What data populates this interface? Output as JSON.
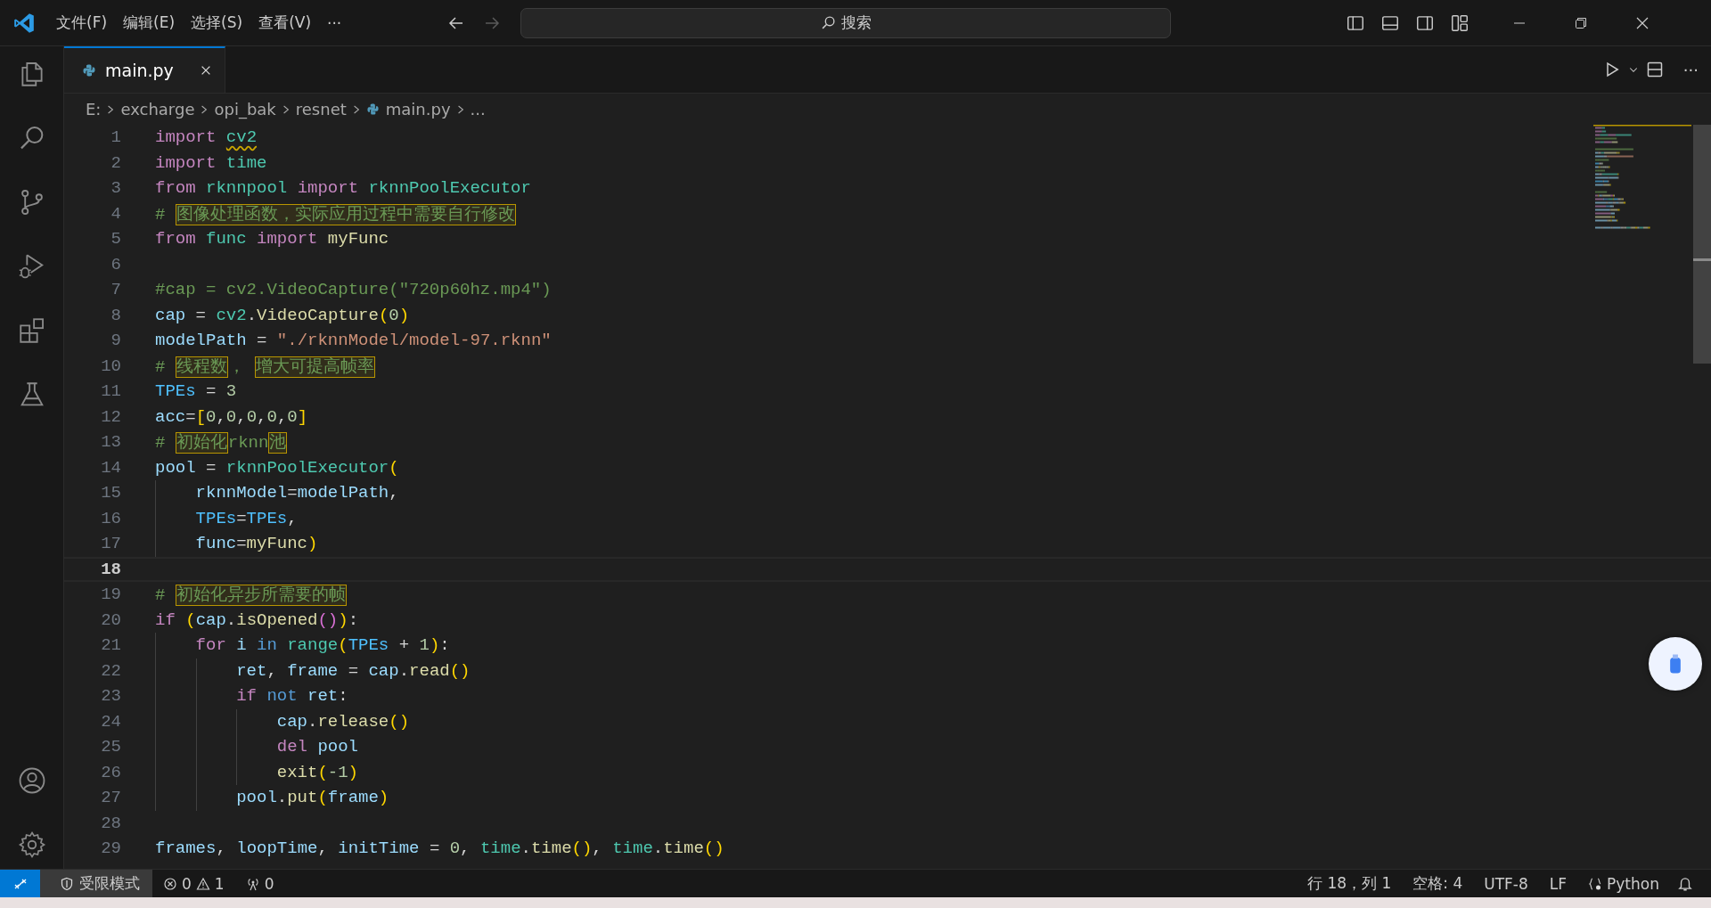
{
  "title_bar": {
    "menus": [
      "文件(F)",
      "编辑(E)",
      "选择(S)",
      "查看(V)"
    ],
    "more": "···",
    "nav": [
      {
        "kind": "back",
        "disabled": false
      },
      {
        "kind": "forward",
        "disabled": true
      }
    ],
    "search": "搜索"
  },
  "tabs": [
    {
      "label": "main.py",
      "selected": true
    }
  ],
  "editor_actions": {
    "more": "···"
  },
  "breadcrumb": [
    {
      "label": "E:",
      "kind": "folder"
    },
    {
      "label": "excharge",
      "kind": "folder"
    },
    {
      "label": "opi_bak",
      "kind": "folder"
    },
    {
      "label": "resnet",
      "kind": "folder"
    },
    {
      "label": "main.py",
      "kind": "file"
    },
    {
      "label": "...",
      "kind": "more"
    }
  ],
  "editor": {
    "lines": [
      {
        "number": "1",
        "current": false,
        "tokens": [
          {
            "kind": "kw",
            "text": "import "
          },
          {
            "kind": "mod-warn",
            "text": "cv2"
          }
        ]
      },
      {
        "number": "2",
        "current": false,
        "tokens": [
          {
            "kind": "kw",
            "text": "import "
          },
          {
            "kind": "mod",
            "text": "time"
          }
        ]
      },
      {
        "number": "3",
        "current": false,
        "tokens": [
          {
            "kind": "kw",
            "text": "from "
          },
          {
            "kind": "mod",
            "text": "rknnpool"
          },
          {
            "kind": "kw",
            "text": " import "
          },
          {
            "kind": "mod",
            "text": "rknnPoolExecutor"
          }
        ]
      },
      {
        "number": "4",
        "current": false,
        "tokens": [
          {
            "kind": "cmt",
            "text": "# "
          },
          {
            "kind": "hl",
            "text": "图像处理函数，实际应用过程中需要自行修改"
          }
        ]
      },
      {
        "number": "5",
        "current": false,
        "tokens": [
          {
            "kind": "kw",
            "text": "from "
          },
          {
            "kind": "mod",
            "text": "func"
          },
          {
            "kind": "kw",
            "text": " import "
          },
          {
            "kind": "fn",
            "text": "myFunc"
          }
        ]
      },
      {
        "number": "6",
        "current": false
      },
      {
        "number": "7",
        "current": false,
        "tokens": [
          {
            "kind": "cmt",
            "text": "#cap = cv2.VideoCapture(\"720p60hz.mp4\")"
          }
        ]
      },
      {
        "number": "8",
        "current": false,
        "tokens": [
          {
            "kind": "var",
            "text": "cap"
          },
          {
            "kind": "op",
            "text": " = "
          },
          {
            "kind": "mod",
            "text": "cv2"
          },
          {
            "kind": "op",
            "text": "."
          },
          {
            "kind": "fn",
            "text": "VideoCapture"
          },
          {
            "kind": "b1",
            "text": "("
          },
          {
            "kind": "num",
            "text": "0"
          },
          {
            "kind": "b1",
            "text": ")"
          }
        ]
      },
      {
        "number": "9",
        "current": false,
        "tokens": [
          {
            "kind": "var",
            "text": "modelPath"
          },
          {
            "kind": "op",
            "text": " = "
          },
          {
            "kind": "str",
            "text": "\"./rknnModel/model-97.rknn\""
          }
        ]
      },
      {
        "number": "10",
        "current": false,
        "tokens": [
          {
            "kind": "cmt",
            "text": "# "
          },
          {
            "kind": "hl",
            "text": "线程数"
          },
          {
            "kind": "cmt",
            "text": "， "
          },
          {
            "kind": "hl",
            "text": "增大可提高帧率"
          }
        ]
      },
      {
        "number": "11",
        "current": false,
        "tokens": [
          {
            "kind": "const",
            "text": "TPEs"
          },
          {
            "kind": "op",
            "text": " = "
          },
          {
            "kind": "num",
            "text": "3"
          }
        ]
      },
      {
        "number": "12",
        "current": false,
        "tokens": [
          {
            "kind": "var",
            "text": "acc"
          },
          {
            "kind": "op",
            "text": "="
          },
          {
            "kind": "b1",
            "text": "["
          },
          {
            "kind": "num",
            "text": "0"
          },
          {
            "kind": "op",
            "text": ","
          },
          {
            "kind": "num",
            "text": "0"
          },
          {
            "kind": "op",
            "text": ","
          },
          {
            "kind": "num",
            "text": "0"
          },
          {
            "kind": "op",
            "text": ","
          },
          {
            "kind": "num",
            "text": "0"
          },
          {
            "kind": "op",
            "text": ","
          },
          {
            "kind": "num",
            "text": "0"
          },
          {
            "kind": "b1",
            "text": "]"
          }
        ]
      },
      {
        "number": "13",
        "current": false,
        "tokens": [
          {
            "kind": "cmt",
            "text": "# "
          },
          {
            "kind": "hl",
            "text": "初始化"
          },
          {
            "kind": "cmt",
            "text": "rknn"
          },
          {
            "kind": "hl",
            "text": "池"
          }
        ]
      },
      {
        "number": "14",
        "current": false,
        "tokens": [
          {
            "kind": "var",
            "text": "pool"
          },
          {
            "kind": "op",
            "text": " = "
          },
          {
            "kind": "mod",
            "text": "rknnPoolExecutor"
          },
          {
            "kind": "b1",
            "text": "("
          }
        ]
      },
      {
        "number": "15",
        "current": false,
        "tokens": [
          {
            "kind": "var",
            "text": "    rknnModel"
          },
          {
            "kind": "op",
            "text": "="
          },
          {
            "kind": "var",
            "text": "modelPath"
          },
          {
            "kind": "op",
            "text": ","
          }
        ]
      },
      {
        "number": "16",
        "current": false,
        "tokens": [
          {
            "kind": "const",
            "text": "    TPEs"
          },
          {
            "kind": "op",
            "text": "="
          },
          {
            "kind": "const",
            "text": "TPEs"
          },
          {
            "kind": "op",
            "text": ","
          }
        ]
      },
      {
        "number": "17",
        "current": false,
        "tokens": [
          {
            "kind": "var",
            "text": "    func"
          },
          {
            "kind": "op",
            "text": "="
          },
          {
            "kind": "fn",
            "text": "myFunc"
          },
          {
            "kind": "b1",
            "text": ")"
          }
        ]
      },
      {
        "number": "18",
        "current": true
      },
      {
        "number": "19",
        "current": false,
        "tokens": [
          {
            "kind": "cmt",
            "text": "# "
          },
          {
            "kind": "hl",
            "text": "初始化异步所需要的帧"
          }
        ]
      },
      {
        "number": "20",
        "current": false,
        "tokens": [
          {
            "kind": "kw",
            "text": "if "
          },
          {
            "kind": "b1",
            "text": "("
          },
          {
            "kind": "var",
            "text": "cap"
          },
          {
            "kind": "op",
            "text": "."
          },
          {
            "kind": "fn",
            "text": "isOpened"
          },
          {
            "kind": "b2",
            "text": "()"
          },
          {
            "kind": "b1",
            "text": ")"
          },
          {
            "kind": "op",
            "text": ":"
          }
        ]
      },
      {
        "number": "21",
        "current": false,
        "tokens": [
          {
            "kind": "kw",
            "text": "    for "
          },
          {
            "kind": "var",
            "text": "i"
          },
          {
            "kind": "kw2",
            "text": " in "
          },
          {
            "kind": "mod",
            "text": "range"
          },
          {
            "kind": "b1",
            "text": "("
          },
          {
            "kind": "const",
            "text": "TPEs"
          },
          {
            "kind": "op",
            "text": " + "
          },
          {
            "kind": "num",
            "text": "1"
          },
          {
            "kind": "b1",
            "text": ")"
          },
          {
            "kind": "op",
            "text": ":"
          }
        ]
      },
      {
        "number": "22",
        "current": false,
        "tokens": [
          {
            "kind": "var",
            "text": "        ret"
          },
          {
            "kind": "op",
            "text": ", "
          },
          {
            "kind": "var",
            "text": "frame"
          },
          {
            "kind": "op",
            "text": " = "
          },
          {
            "kind": "var",
            "text": "cap"
          },
          {
            "kind": "op",
            "text": "."
          },
          {
            "kind": "fn",
            "text": "read"
          },
          {
            "kind": "b1",
            "text": "()"
          }
        ]
      },
      {
        "number": "23",
        "current": false,
        "tokens": [
          {
            "kind": "kw",
            "text": "        if "
          },
          {
            "kind": "kw2",
            "text": "not "
          },
          {
            "kind": "var",
            "text": "ret"
          },
          {
            "kind": "op",
            "text": ":"
          }
        ]
      },
      {
        "number": "24",
        "current": false,
        "tokens": [
          {
            "kind": "var",
            "text": "            cap"
          },
          {
            "kind": "op",
            "text": "."
          },
          {
            "kind": "fn",
            "text": "release"
          },
          {
            "kind": "b1",
            "text": "()"
          }
        ]
      },
      {
        "number": "25",
        "current": false,
        "tokens": [
          {
            "kind": "kw",
            "text": "            del "
          },
          {
            "kind": "var",
            "text": "pool"
          }
        ]
      },
      {
        "number": "26",
        "current": false,
        "tokens": [
          {
            "kind": "fn",
            "text": "            exit"
          },
          {
            "kind": "b1",
            "text": "("
          },
          {
            "kind": "num",
            "text": "-1"
          },
          {
            "kind": "b1",
            "text": ")"
          }
        ]
      },
      {
        "number": "27",
        "current": false,
        "tokens": [
          {
            "kind": "var",
            "text": "        pool"
          },
          {
            "kind": "op",
            "text": "."
          },
          {
            "kind": "fn",
            "text": "put"
          },
          {
            "kind": "b1",
            "text": "("
          },
          {
            "kind": "var",
            "text": "frame"
          },
          {
            "kind": "b1",
            "text": ")"
          }
        ]
      },
      {
        "number": "28",
        "current": false
      },
      {
        "number": "29",
        "current": false,
        "tokens": [
          {
            "kind": "var",
            "text": "frames"
          },
          {
            "kind": "op",
            "text": ", "
          },
          {
            "kind": "var",
            "text": "loopTime"
          },
          {
            "kind": "op",
            "text": ", "
          },
          {
            "kind": "var",
            "text": "initTime"
          },
          {
            "kind": "op",
            "text": " = "
          },
          {
            "kind": "num",
            "text": "0"
          },
          {
            "kind": "op",
            "text": ", "
          },
          {
            "kind": "mod",
            "text": "time"
          },
          {
            "kind": "op",
            "text": "."
          },
          {
            "kind": "fn",
            "text": "time"
          },
          {
            "kind": "b1",
            "text": "()"
          },
          {
            "kind": "op",
            "text": ", "
          },
          {
            "kind": "mod",
            "text": "time"
          },
          {
            "kind": "op",
            "text": "."
          },
          {
            "kind": "fn",
            "text": "time"
          },
          {
            "kind": "b1",
            "text": "()"
          }
        ]
      }
    ]
  },
  "status_bar": {
    "restricted_mode": "受限模式",
    "errors": "0",
    "warnings": "1",
    "ports": "0",
    "position": "行 18，列 1",
    "indentation": "空格: 4",
    "encoding": "UTF-8",
    "eol": "LF",
    "language": "Python"
  }
}
